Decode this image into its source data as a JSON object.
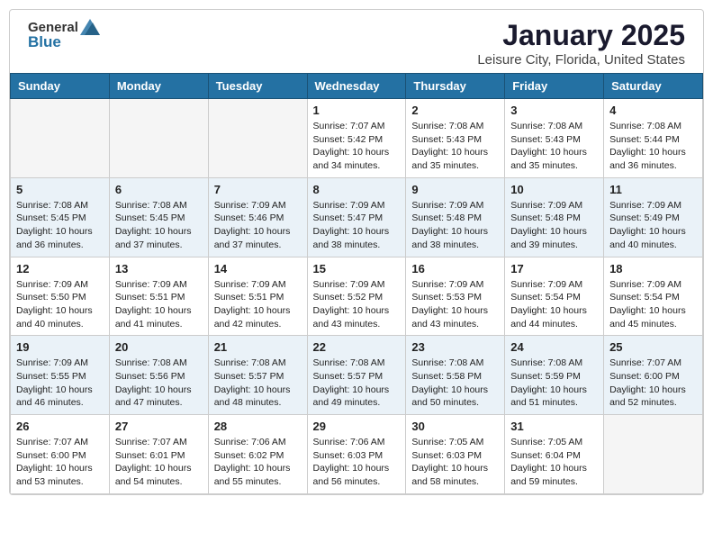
{
  "header": {
    "logo_general": "General",
    "logo_blue": "Blue",
    "title": "January 2025",
    "location": "Leisure City, Florida, United States"
  },
  "weekdays": [
    "Sunday",
    "Monday",
    "Tuesday",
    "Wednesday",
    "Thursday",
    "Friday",
    "Saturday"
  ],
  "weeks": [
    [
      {
        "day": "",
        "info": ""
      },
      {
        "day": "",
        "info": ""
      },
      {
        "day": "",
        "info": ""
      },
      {
        "day": "1",
        "info": "Sunrise: 7:07 AM\nSunset: 5:42 PM\nDaylight: 10 hours\nand 34 minutes."
      },
      {
        "day": "2",
        "info": "Sunrise: 7:08 AM\nSunset: 5:43 PM\nDaylight: 10 hours\nand 35 minutes."
      },
      {
        "day": "3",
        "info": "Sunrise: 7:08 AM\nSunset: 5:43 PM\nDaylight: 10 hours\nand 35 minutes."
      },
      {
        "day": "4",
        "info": "Sunrise: 7:08 AM\nSunset: 5:44 PM\nDaylight: 10 hours\nand 36 minutes."
      }
    ],
    [
      {
        "day": "5",
        "info": "Sunrise: 7:08 AM\nSunset: 5:45 PM\nDaylight: 10 hours\nand 36 minutes."
      },
      {
        "day": "6",
        "info": "Sunrise: 7:08 AM\nSunset: 5:45 PM\nDaylight: 10 hours\nand 37 minutes."
      },
      {
        "day": "7",
        "info": "Sunrise: 7:09 AM\nSunset: 5:46 PM\nDaylight: 10 hours\nand 37 minutes."
      },
      {
        "day": "8",
        "info": "Sunrise: 7:09 AM\nSunset: 5:47 PM\nDaylight: 10 hours\nand 38 minutes."
      },
      {
        "day": "9",
        "info": "Sunrise: 7:09 AM\nSunset: 5:48 PM\nDaylight: 10 hours\nand 38 minutes."
      },
      {
        "day": "10",
        "info": "Sunrise: 7:09 AM\nSunset: 5:48 PM\nDaylight: 10 hours\nand 39 minutes."
      },
      {
        "day": "11",
        "info": "Sunrise: 7:09 AM\nSunset: 5:49 PM\nDaylight: 10 hours\nand 40 minutes."
      }
    ],
    [
      {
        "day": "12",
        "info": "Sunrise: 7:09 AM\nSunset: 5:50 PM\nDaylight: 10 hours\nand 40 minutes."
      },
      {
        "day": "13",
        "info": "Sunrise: 7:09 AM\nSunset: 5:51 PM\nDaylight: 10 hours\nand 41 minutes."
      },
      {
        "day": "14",
        "info": "Sunrise: 7:09 AM\nSunset: 5:51 PM\nDaylight: 10 hours\nand 42 minutes."
      },
      {
        "day": "15",
        "info": "Sunrise: 7:09 AM\nSunset: 5:52 PM\nDaylight: 10 hours\nand 43 minutes."
      },
      {
        "day": "16",
        "info": "Sunrise: 7:09 AM\nSunset: 5:53 PM\nDaylight: 10 hours\nand 43 minutes."
      },
      {
        "day": "17",
        "info": "Sunrise: 7:09 AM\nSunset: 5:54 PM\nDaylight: 10 hours\nand 44 minutes."
      },
      {
        "day": "18",
        "info": "Sunrise: 7:09 AM\nSunset: 5:54 PM\nDaylight: 10 hours\nand 45 minutes."
      }
    ],
    [
      {
        "day": "19",
        "info": "Sunrise: 7:09 AM\nSunset: 5:55 PM\nDaylight: 10 hours\nand 46 minutes."
      },
      {
        "day": "20",
        "info": "Sunrise: 7:08 AM\nSunset: 5:56 PM\nDaylight: 10 hours\nand 47 minutes."
      },
      {
        "day": "21",
        "info": "Sunrise: 7:08 AM\nSunset: 5:57 PM\nDaylight: 10 hours\nand 48 minutes."
      },
      {
        "day": "22",
        "info": "Sunrise: 7:08 AM\nSunset: 5:57 PM\nDaylight: 10 hours\nand 49 minutes."
      },
      {
        "day": "23",
        "info": "Sunrise: 7:08 AM\nSunset: 5:58 PM\nDaylight: 10 hours\nand 50 minutes."
      },
      {
        "day": "24",
        "info": "Sunrise: 7:08 AM\nSunset: 5:59 PM\nDaylight: 10 hours\nand 51 minutes."
      },
      {
        "day": "25",
        "info": "Sunrise: 7:07 AM\nSunset: 6:00 PM\nDaylight: 10 hours\nand 52 minutes."
      }
    ],
    [
      {
        "day": "26",
        "info": "Sunrise: 7:07 AM\nSunset: 6:00 PM\nDaylight: 10 hours\nand 53 minutes."
      },
      {
        "day": "27",
        "info": "Sunrise: 7:07 AM\nSunset: 6:01 PM\nDaylight: 10 hours\nand 54 minutes."
      },
      {
        "day": "28",
        "info": "Sunrise: 7:06 AM\nSunset: 6:02 PM\nDaylight: 10 hours\nand 55 minutes."
      },
      {
        "day": "29",
        "info": "Sunrise: 7:06 AM\nSunset: 6:03 PM\nDaylight: 10 hours\nand 56 minutes."
      },
      {
        "day": "30",
        "info": "Sunrise: 7:05 AM\nSunset: 6:03 PM\nDaylight: 10 hours\nand 58 minutes."
      },
      {
        "day": "31",
        "info": "Sunrise: 7:05 AM\nSunset: 6:04 PM\nDaylight: 10 hours\nand 59 minutes."
      },
      {
        "day": "",
        "info": ""
      }
    ]
  ]
}
